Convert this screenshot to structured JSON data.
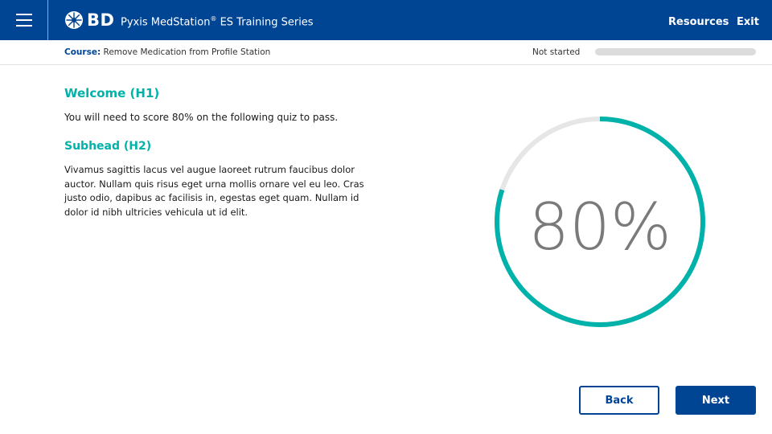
{
  "header": {
    "menu_icon": "hamburger-menu-icon",
    "logo_icon": "bd-starburst-logo-icon",
    "logo_text": "BD",
    "title": "Pyxis MedStation",
    "title_mark": "®",
    "title_suffix": " ES Training Series",
    "links": {
      "resources": "Resources",
      "exit": "Exit"
    }
  },
  "course": {
    "label": "Course:",
    "name": " Remove Medication from Profile Station",
    "status": "Not started",
    "progress": 0
  },
  "content": {
    "h1": "Welcome (H1)",
    "intro": "You will need to score 80% on the following quiz to pass.",
    "h2": "Subhead (H2)",
    "body": "Vivamus sagittis lacus vel augue laoreet rutrum faucibus dolor auctor. Nullam quis risus eget urna mollis ornare vel eu leo. Cras justo odio, dapibus ac facilisis in, egestas eget quam. Nullam id dolor id nibh ultricies vehicula ut id elit."
  },
  "score": {
    "label": "80%",
    "value": 80
  },
  "nav": {
    "back": "Back",
    "next": "Next"
  },
  "colors": {
    "brand": "#004593",
    "accent": "#00b2a9",
    "track": "#e6e6e6",
    "score_text": "#7a7a7a"
  }
}
